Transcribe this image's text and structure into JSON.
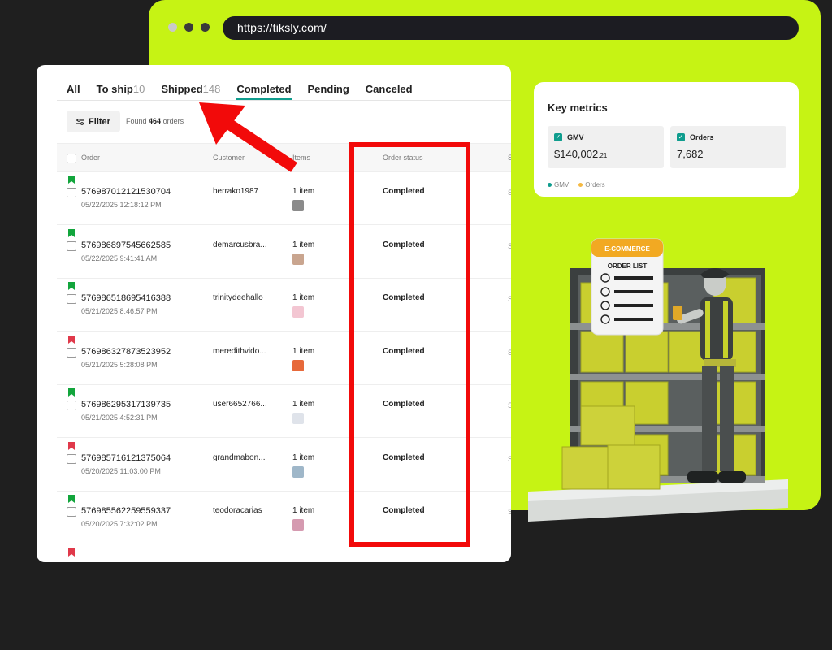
{
  "browser": {
    "url": "https://tiksly.com/",
    "dot_colors": [
      "#c9c9c9",
      "#3a3a3a",
      "#3a3a3a"
    ]
  },
  "orders": {
    "tabs": [
      {
        "label": "All",
        "count": ""
      },
      {
        "label": "To ship",
        "count": "10"
      },
      {
        "label": "Shipped",
        "count": "148"
      },
      {
        "label": "Completed",
        "count": ""
      },
      {
        "label": "Pending",
        "count": ""
      },
      {
        "label": "Canceled",
        "count": ""
      }
    ],
    "filter_label": "Filter",
    "found_prefix": "Found",
    "found_count": "464",
    "found_suffix": "orders",
    "columns": {
      "order": "Order",
      "customer": "Customer",
      "items": "Items",
      "status": "Order status",
      "extra": "S"
    },
    "rows": [
      {
        "flag": "#12a53c",
        "id": "576987012121530704",
        "date": "05/22/2025 12:18:12 PM",
        "customer": "berrako1987",
        "items": "1 item",
        "thumb": "#8b8b8b",
        "status": "Completed"
      },
      {
        "flag": "#12a53c",
        "id": "576986897545662585",
        "date": "05/22/2025 9:41:41 AM",
        "customer": "demarcusbra...",
        "items": "1 item",
        "thumb": "#c9a58f",
        "status": "Completed"
      },
      {
        "flag": "#12a53c",
        "id": "576986518695416388",
        "date": "05/21/2025 8:46:57 PM",
        "customer": "trinitydeehallo",
        "items": "1 item",
        "thumb": "#f3c6d2",
        "status": "Completed"
      },
      {
        "flag": "#e0394a",
        "id": "576986327873523952",
        "date": "05/21/2025 5:28:08 PM",
        "customer": "meredithvido...",
        "items": "1 item",
        "thumb": "#e7693a",
        "status": "Completed"
      },
      {
        "flag": "#12a53c",
        "id": "576986295317139735",
        "date": "05/21/2025 4:52:31 PM",
        "customer": "user6652766...",
        "items": "1 item",
        "thumb": "#dfe3ea",
        "status": "Completed"
      },
      {
        "flag": "#e0394a",
        "id": "576985716121375064",
        "date": "05/20/2025 11:03:00 PM",
        "customer": "grandmabon...",
        "items": "1 item",
        "thumb": "#9fb7c9",
        "status": "Completed"
      },
      {
        "flag": "#12a53c",
        "id": "576985562259559337",
        "date": "05/20/2025 7:32:02 PM",
        "customer": "teodoracarias",
        "items": "1 item",
        "thumb": "#d59ab0",
        "status": "Completed"
      },
      {
        "flag": "#e0394a",
        "id": "",
        "date": "",
        "customer": "",
        "items": "",
        "thumb": "",
        "status": ""
      }
    ]
  },
  "metrics": {
    "title": "Key metrics",
    "cards": [
      {
        "label": "GMV",
        "value": "$140,002",
        "decimals": ".21"
      },
      {
        "label": "Orders",
        "value": "7,682",
        "decimals": ""
      }
    ],
    "legend": [
      {
        "label": "GMV",
        "color": "#0f9d8e"
      },
      {
        "label": "Orders",
        "color": "#f5b942"
      }
    ]
  },
  "illustration": {
    "badge": "E-COMMERCE",
    "clipboard_title": "ORDER LIST"
  }
}
